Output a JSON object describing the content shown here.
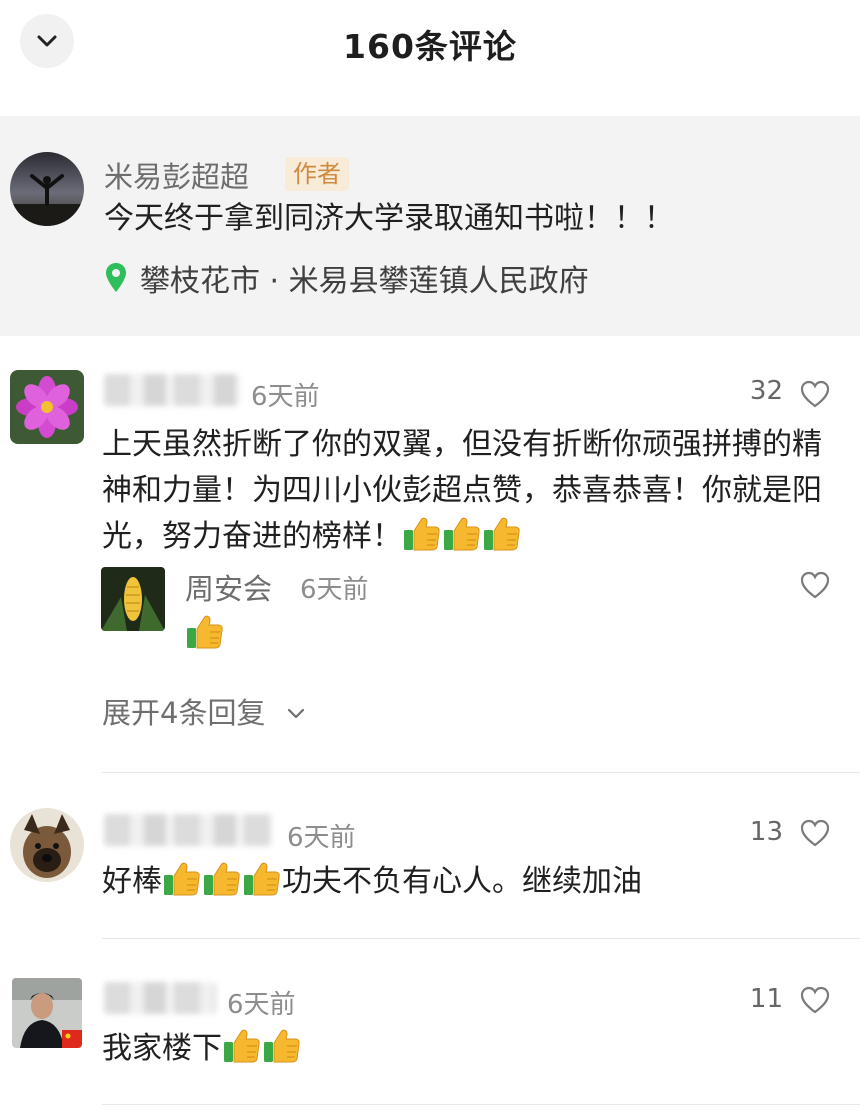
{
  "header": {
    "title": "160条评论"
  },
  "author_post": {
    "name": "米易彭超超",
    "badge": "作者",
    "text": "今天终于拿到同济大学录取通知书啦！！！",
    "location": "攀枝花市 · 米易县攀莲镇人民政府"
  },
  "comments": [
    {
      "time": "6天前",
      "likes": "32",
      "text": "上天虽然折断了你的双翼，但没有折断你顽强拼搏的精神和力量！为四川小伙彭超点赞，恭喜恭喜！你就是阳光，努力奋进的榜样！",
      "emoji_count": 3,
      "reply": {
        "name": "周安会",
        "time": "6天前",
        "emoji_count": 1
      },
      "expand_label": "展开4条回复"
    },
    {
      "time": "6天前",
      "likes": "13",
      "text_before": "好棒",
      "emoji_count": 3,
      "text_after": "功夫不负有心人。继续加油"
    },
    {
      "time": "6天前",
      "likes": "11",
      "text_before": "我家楼下",
      "emoji_count": 2
    }
  ],
  "colors": {
    "badge_bg": "#f8ecd8",
    "badge_text": "#d08a40",
    "location_pin": "#2fbf5a",
    "thumb_yellow": "#f5b82e",
    "thumb_green": "#3aa845"
  },
  "icons": [
    "chevron-down-icon",
    "location-pin-icon",
    "heart-outline-icon",
    "thumbs-up-emoji"
  ]
}
